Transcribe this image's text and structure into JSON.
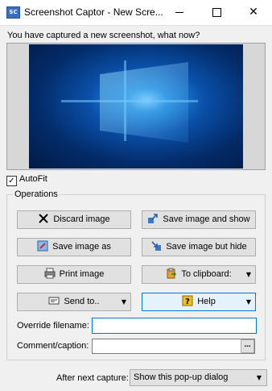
{
  "window": {
    "app_icon": "SC",
    "title": "Screenshot Captor - New Scre...",
    "minimize_icon": "minimize-icon",
    "maximize_icon": "maximize-icon",
    "close_glyph": "✕"
  },
  "prompt": "You have captured a new screenshot, what now?",
  "autofit": {
    "label": "AutoFit",
    "checked": true,
    "check_glyph": "✓"
  },
  "operations": {
    "title": "Operations",
    "buttons": {
      "discard": {
        "label": "Discard image",
        "icon": "discard-x-icon"
      },
      "save_show": {
        "label": "Save image and show",
        "icon": "save-show-icon"
      },
      "save_as": {
        "label": "Save image as",
        "icon": "save-as-icon"
      },
      "save_hide": {
        "label": "Save image but hide",
        "icon": "save-hide-icon"
      },
      "print": {
        "label": "Print image",
        "icon": "printer-icon"
      },
      "clipboard": {
        "label": "To clipboard:",
        "icon": "clipboard-icon",
        "dropdown": "▼"
      },
      "send_to": {
        "label": "Send to..",
        "icon": "send-to-icon",
        "dropdown": "▼"
      },
      "help": {
        "label": "Help",
        "icon": "help-icon",
        "dropdown": "▼"
      }
    },
    "override_filename": {
      "label": "Override filename:",
      "value": ""
    },
    "comment_caption": {
      "label": "Comment/caption:",
      "value": "",
      "browse_label": "..."
    }
  },
  "after_capture": {
    "label": "After next capture:",
    "selected": "Show this pop-up dialog",
    "dropdown": "▼"
  },
  "colors": {
    "accent": "#0078d7",
    "button_face": "#e1e1e1",
    "window_bg": "#f0f0f0"
  }
}
